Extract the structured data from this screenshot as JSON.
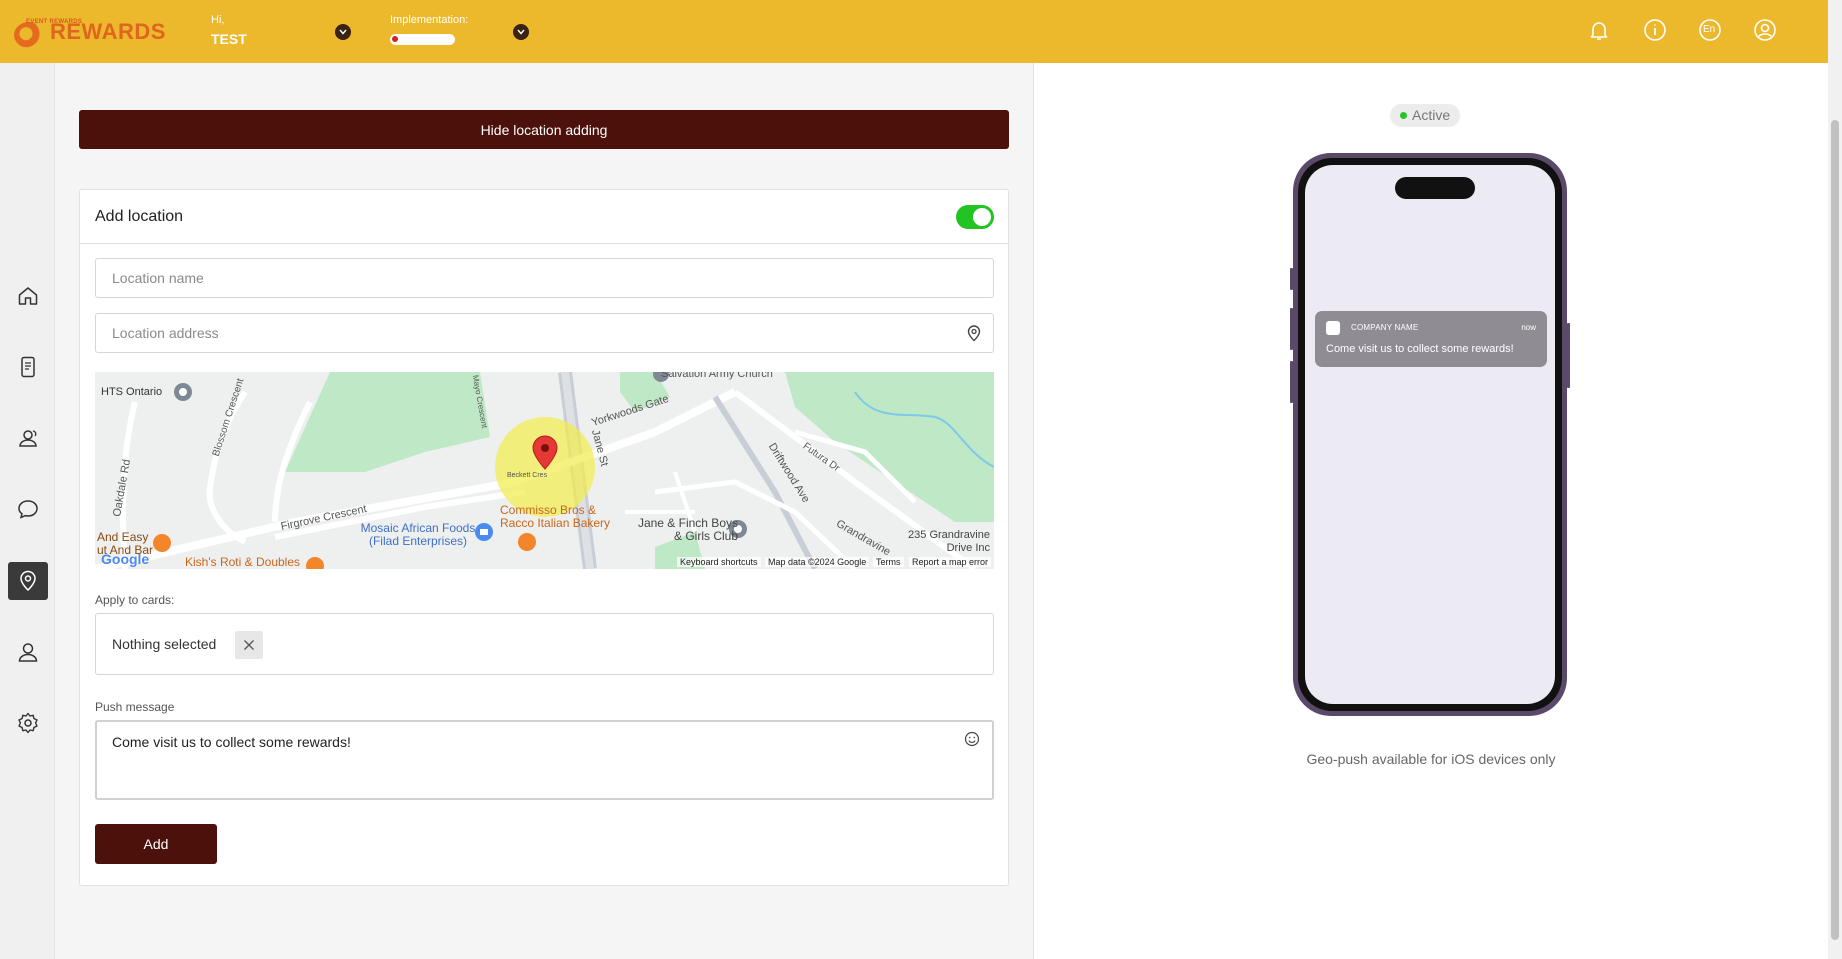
{
  "app": {
    "logo_small": "EVENT REWARDS",
    "logo_text": "REWARDS",
    "greeting": "Hi,",
    "user_name": "TEST",
    "implementation_label": "Implementation:",
    "implementation_progress": 0.1
  },
  "topbar_icons": [
    "bell-icon",
    "info-icon",
    "language-icon",
    "user-icon"
  ],
  "language_code": "En",
  "sidebar": {
    "items": [
      "home-icon",
      "mobile-card-icon",
      "customers-icon",
      "messages-icon",
      "location-icon",
      "profile-icon",
      "settings-icon"
    ],
    "active_index": 4
  },
  "main": {
    "hide_button_label": "Hide location adding",
    "card_title": "Add location",
    "toggle_on": true,
    "location_name_placeholder": "Location name",
    "location_address_placeholder": "Location address",
    "apply_to_cards_label": "Apply to cards:",
    "cards_selection": "Nothing selected",
    "push_message_label": "Push message",
    "push_message_value": "Come visit us to collect some rewards!",
    "add_button_label": "Add"
  },
  "map": {
    "streets": [
      "Salvation Army Church",
      "HTS Ontario",
      "Yorkwoods Gate",
      "Firgrove Crescent",
      "Blossom Crescent",
      "Oakdale Rd",
      "Driftwood Ave",
      "Futura Dr",
      "Jane St",
      "Grandravine",
      "Beckett Cres",
      "Mayo Crescent"
    ],
    "places": {
      "mosaic": "Mosaic African Foods (Filad Enterprises)",
      "commisso": "Commisso Bros & Racco Italian Bakery",
      "janefinch": "Jane & Finch Boys & Girls Club",
      "grandravine": "235 Grandravine Drive Inc",
      "kish": "Kish's Roti & Doubles",
      "andeasy": "And Easy ut And Bar"
    },
    "footer": {
      "google": "Google",
      "shortcuts": "Keyboard shortcuts",
      "mapdata": "Map data ©2024 Google",
      "terms": "Terms",
      "report": "Report a map error"
    }
  },
  "preview": {
    "status": "Active",
    "notification_app": "COMPANY NAME",
    "notification_time": "now",
    "notification_message": "Come visit us to collect some rewards!",
    "note": "Geo-push available for iOS devices only"
  },
  "colors": {
    "topbar": "#ecb82c",
    "primary_button": "#4b110a",
    "toggle": "#24c324",
    "active_dot": "#27c427"
  }
}
